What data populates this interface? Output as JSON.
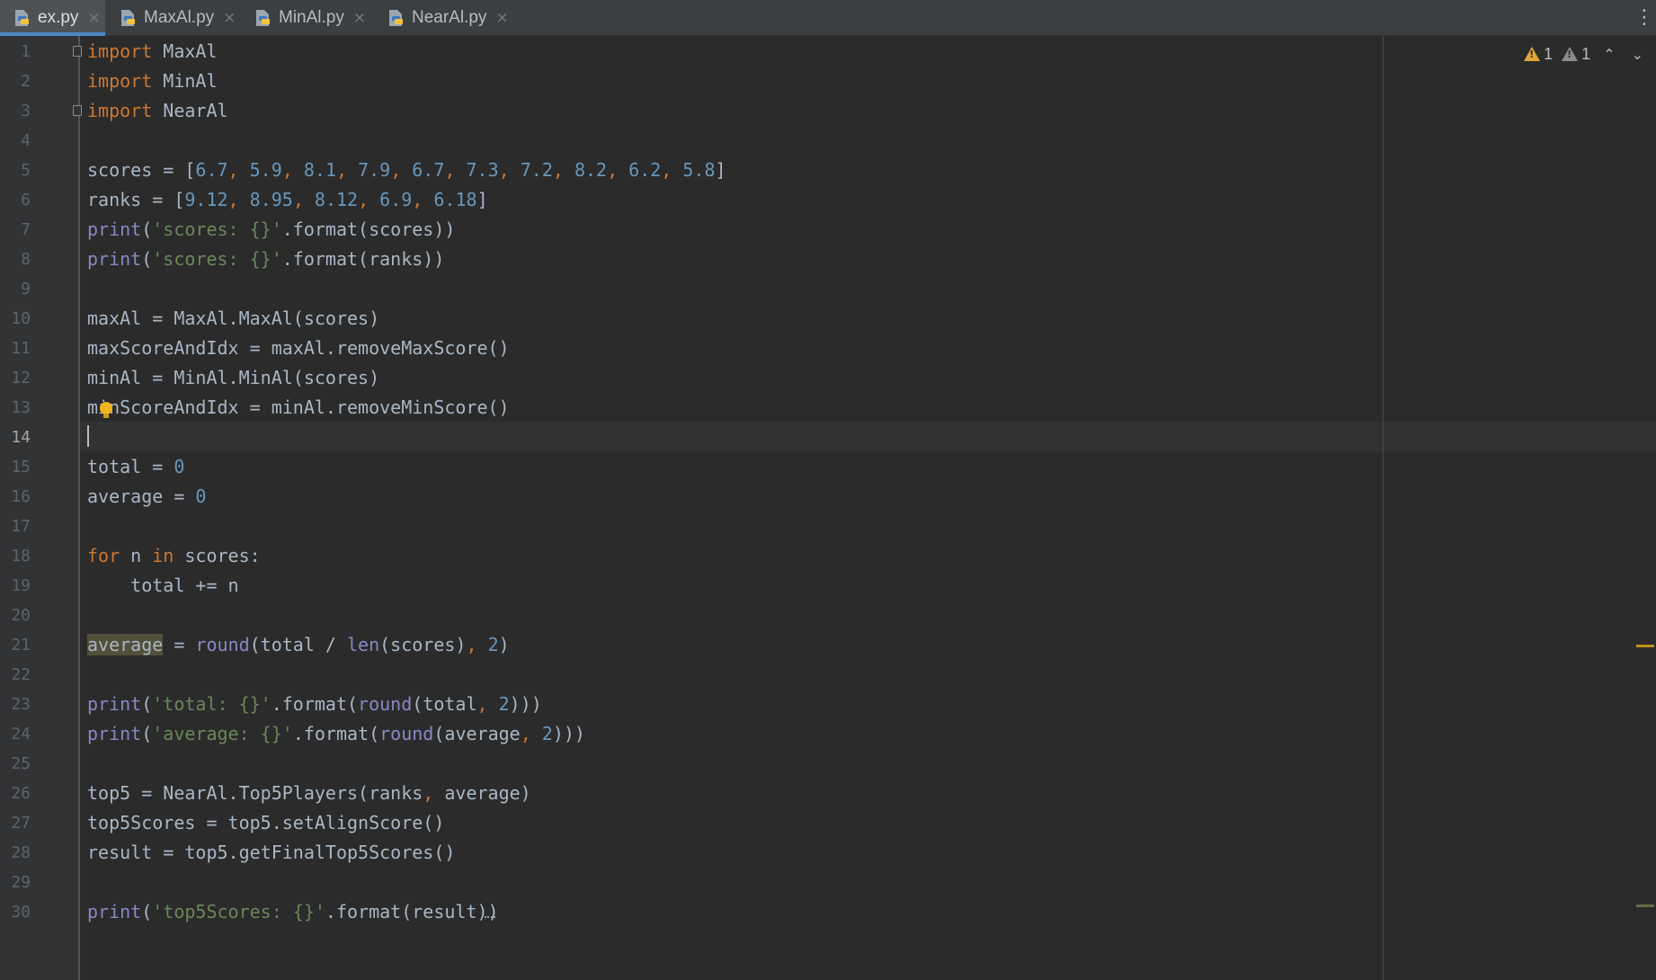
{
  "tabs": [
    {
      "label": "ex.py",
      "active": true
    },
    {
      "label": "MaxAl.py",
      "active": false
    },
    {
      "label": "MinAl.py",
      "active": false
    },
    {
      "label": "NearAl.py",
      "active": false
    }
  ],
  "tab_close_glyph": "×",
  "menu_glyph": "⋮",
  "inspections": {
    "warnings": "1",
    "weak_warnings": "1",
    "prev_icon": "chevron-up-icon",
    "next_icon": "chevron-down-icon"
  },
  "current_line": 14,
  "line_numbers": [
    "1",
    "2",
    "3",
    "4",
    "5",
    "6",
    "7",
    "8",
    "9",
    "10",
    "11",
    "12",
    "13",
    "14",
    "15",
    "16",
    "17",
    "18",
    "19",
    "20",
    "21",
    "22",
    "23",
    "24",
    "25",
    "26",
    "27",
    "28",
    "29",
    "30"
  ],
  "code": [
    "import MaxAl",
    "import MinAl",
    "import NearAl",
    "",
    "scores = [6.7, 5.9, 8.1, 7.9, 6.7, 7.3, 7.2, 8.2, 6.2, 5.8]",
    "ranks = [9.12, 8.95, 8.12, 6.9, 6.18]",
    "print('scores: {}'.format(scores))",
    "print('scores: {}'.format(ranks))",
    "",
    "maxAl = MaxAl.MaxAl(scores)",
    "maxScoreAndIdx = maxAl.removeMaxScore()",
    "minAl = MinAl.MinAl(scores)",
    "minScoreAndIdx = minAl.removeMinScore()",
    "",
    "total = 0",
    "average = 0",
    "",
    "for n in scores:",
    "    total += n",
    "",
    "average = round(total / len(scores), 2)",
    "",
    "print('total: {}'.format(round(total, 2)))",
    "print('average: {}'.format(round(average, 2)))",
    "",
    "top5 = NearAl.Top5Players(ranks, average)",
    "top5Scores = top5.setAlignScore()",
    "result = top5.getFinalTop5Scores()",
    "",
    "print('top5Scores: {}'.format(result))"
  ],
  "colors": {
    "keyword": "#cc7832",
    "number": "#6897bb",
    "string": "#6a8759",
    "builtin": "#8888c6",
    "text": "#a9b7c6",
    "background": "#2b2b2b",
    "warning": "#e0a43a"
  }
}
